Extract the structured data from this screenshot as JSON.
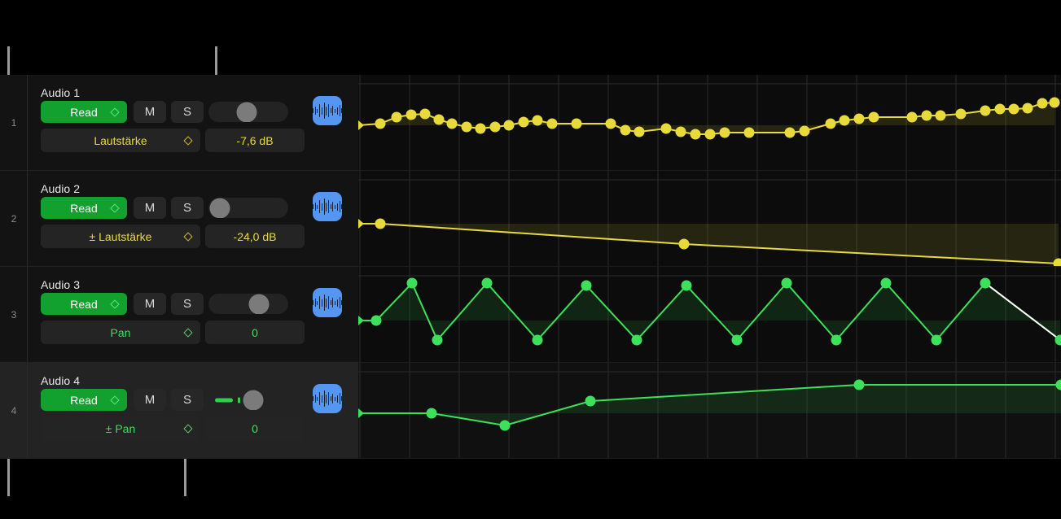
{
  "app": {
    "context": "logic-automation-track-lanes",
    "colors": {
      "volume": "#e7da3a",
      "pan": "#3ce05a",
      "read_button": "#12a02e",
      "waveform_icon": "#5596f2",
      "selected_row": "#232323",
      "leader_line": "#9a9a9a"
    }
  },
  "tracks": [
    {
      "number": "1",
      "name": "Audio 1",
      "automation_mode": "Read",
      "mute_label": "M",
      "solo_label": "S",
      "parameter": "Lautstärke",
      "value": "-7,6 dB",
      "value_color": "#e7da3a",
      "slider_percent": 48,
      "slider_fill": false,
      "selected": false,
      "waveform_icon": "waveform-icon"
    },
    {
      "number": "2",
      "name": "Audio 2",
      "automation_mode": "Read",
      "mute_label": "M",
      "solo_label": "S",
      "parameter": "± Lautstärke",
      "value": "-24,0 dB",
      "value_color": "#e7da3a",
      "slider_percent": 14,
      "slider_fill": false,
      "selected": false,
      "waveform_icon": "waveform-icon"
    },
    {
      "number": "3",
      "name": "Audio 3",
      "automation_mode": "Read",
      "mute_label": "M",
      "solo_label": "S",
      "parameter": "Pan",
      "value": "0",
      "value_color": "#3ce05a",
      "slider_percent": 63,
      "slider_fill": false,
      "selected": false,
      "waveform_icon": "waveform-icon"
    },
    {
      "number": "4",
      "name": "Audio 4",
      "automation_mode": "Read",
      "mute_label": "M",
      "solo_label": "S",
      "parameter": "± Pan",
      "value": "0",
      "value_color": "#3ce05a",
      "slider_percent": 56,
      "slider_fill": true,
      "selected": true,
      "waveform_icon": "waveform-icon"
    }
  ],
  "chart_data": [
    {
      "type": "line",
      "title": "Audio 1 — Lautstärke automation",
      "color": "#e7da3a",
      "lane": 1,
      "baseline_y": 62,
      "ylim": [
        0,
        118
      ],
      "xlim": [
        0,
        863
      ],
      "points": [
        [
          0,
          62
        ],
        [
          27,
          60
        ],
        [
          47,
          52
        ],
        [
          65,
          49
        ],
        [
          82,
          48
        ],
        [
          99,
          55
        ],
        [
          115,
          60
        ],
        [
          133,
          64
        ],
        [
          150,
          66
        ],
        [
          168,
          64
        ],
        [
          185,
          62
        ],
        [
          203,
          58
        ],
        [
          220,
          56
        ],
        [
          238,
          60
        ],
        [
          268,
          60
        ],
        [
          310,
          60
        ],
        [
          328,
          68
        ],
        [
          345,
          70
        ],
        [
          378,
          66
        ],
        [
          396,
          70
        ],
        [
          414,
          73
        ],
        [
          432,
          73
        ],
        [
          450,
          71
        ],
        [
          480,
          71
        ],
        [
          530,
          71
        ],
        [
          548,
          69
        ],
        [
          580,
          60
        ],
        [
          597,
          56
        ],
        [
          615,
          54
        ],
        [
          633,
          52
        ],
        [
          680,
          52
        ],
        [
          698,
          50
        ],
        [
          715,
          50
        ],
        [
          740,
          48
        ],
        [
          770,
          44
        ],
        [
          788,
          42
        ],
        [
          805,
          42
        ],
        [
          822,
          41
        ],
        [
          840,
          35
        ],
        [
          855,
          34
        ]
      ]
    },
    {
      "type": "line",
      "title": "Audio 2 — ± Lautstärke automation",
      "color": "#e7da3a",
      "lane": 2,
      "baseline_y": 65,
      "ylim": [
        0,
        118
      ],
      "xlim": [
        0,
        863
      ],
      "points": [
        [
          0,
          65
        ],
        [
          27,
          65
        ],
        [
          400,
          90
        ],
        [
          860,
          114
        ]
      ]
    },
    {
      "type": "line",
      "title": "Audio 3 — Pan automation",
      "color": "#3ce05a",
      "lane": 3,
      "baseline_y": 66,
      "ylim": [
        0,
        118
      ],
      "xlim": [
        0,
        863
      ],
      "points": [
        [
          0,
          66
        ],
        [
          22,
          66
        ],
        [
          66,
          20
        ],
        [
          97,
          90
        ],
        [
          158,
          20
        ],
        [
          220,
          90
        ],
        [
          280,
          23
        ],
        [
          342,
          90
        ],
        [
          403,
          23
        ],
        [
          465,
          90
        ],
        [
          526,
          20
        ],
        [
          587,
          90
        ],
        [
          648,
          20
        ],
        [
          710,
          90
        ],
        [
          770,
          20
        ],
        [
          862,
          90
        ]
      ],
      "highlighted_segment": {
        "from": [
          770,
          20
        ],
        "to": [
          862,
          90
        ],
        "color": "#ffffff"
      }
    },
    {
      "type": "line",
      "title": "Audio 4 — ± Pan automation",
      "color": "#3ce05a",
      "lane": 4,
      "baseline_y": 62,
      "ylim": [
        0,
        118
      ],
      "xlim": [
        0,
        863
      ],
      "points": [
        [
          0,
          62
        ],
        [
          90,
          62
        ],
        [
          180,
          77
        ],
        [
          285,
          47
        ],
        [
          615,
          27
        ],
        [
          863,
          27
        ]
      ]
    }
  ],
  "leader_lines": [
    {
      "name": "callout-to-volume-parameter",
      "description": "from left edge down to Lautstärke field"
    },
    {
      "name": "callout-to-volume-value",
      "description": "vertical line above -24,0 dB value field"
    },
    {
      "name": "callout-to-pan-parameter",
      "description": "from lower left up to Pan field"
    },
    {
      "name": "callout-to-pan-chevron",
      "description": "vertical line below ± Pan chevron"
    }
  ]
}
